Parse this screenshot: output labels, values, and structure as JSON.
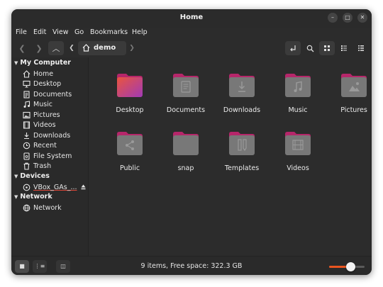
{
  "window": {
    "title": "Home",
    "controls": [
      "minimize-icon",
      "maximize-icon",
      "close-icon"
    ]
  },
  "menubar": [
    "File",
    "Edit",
    "View",
    "Go",
    "Bookmarks",
    "Help"
  ],
  "toolbar": {
    "path": "demo",
    "buttons": [
      "back-icon",
      "forward-icon",
      "parent-folder-icon",
      "path-left-icon",
      "home-icon",
      "path-right-icon",
      "toggle-location-icon",
      "search-icon",
      "icon-view-icon",
      "list-view-icon",
      "compact-view-icon"
    ]
  },
  "sidebar": {
    "sections": [
      {
        "title": "My Computer",
        "items": [
          {
            "label": "Home",
            "icon": "home-icon"
          },
          {
            "label": "Desktop",
            "icon": "desktop-icon"
          },
          {
            "label": "Documents",
            "icon": "documents-icon"
          },
          {
            "label": "Music",
            "icon": "music-icon"
          },
          {
            "label": "Pictures",
            "icon": "pictures-icon"
          },
          {
            "label": "Videos",
            "icon": "videos-icon"
          },
          {
            "label": "Downloads",
            "icon": "downloads-icon"
          },
          {
            "label": "Recent",
            "icon": "recent-icon"
          },
          {
            "label": "File System",
            "icon": "filesystem-icon"
          },
          {
            "label": "Trash",
            "icon": "trash-icon"
          }
        ]
      },
      {
        "title": "Devices",
        "items": [
          {
            "label": "VBox_GAs_...",
            "icon": "disc-icon",
            "extra": "eject-icon"
          }
        ]
      },
      {
        "title": "Network",
        "items": [
          {
            "label": "Network",
            "icon": "network-icon"
          }
        ]
      }
    ]
  },
  "files": [
    {
      "name": "Desktop",
      "emblem": "none",
      "colors": [
        "#e9543e",
        "#a13ab6"
      ]
    },
    {
      "name": "Documents",
      "emblem": "document",
      "colors": [
        "#7f7f7f",
        "#6a6a6a"
      ]
    },
    {
      "name": "Downloads",
      "emblem": "download",
      "colors": [
        "#7f7f7f",
        "#6a6a6a"
      ]
    },
    {
      "name": "Music",
      "emblem": "music",
      "colors": [
        "#7f7f7f",
        "#6a6a6a"
      ]
    },
    {
      "name": "Pictures",
      "emblem": "picture",
      "colors": [
        "#7f7f7f",
        "#6a6a6a"
      ]
    },
    {
      "name": "Public",
      "emblem": "share",
      "colors": [
        "#7f7f7f",
        "#6a6a6a"
      ]
    },
    {
      "name": "snap",
      "emblem": "none",
      "colors": [
        "#7f7f7f",
        "#6a6a6a"
      ]
    },
    {
      "name": "Templates",
      "emblem": "template",
      "colors": [
        "#7f7f7f",
        "#6a6a6a"
      ]
    },
    {
      "name": "Videos",
      "emblem": "video",
      "colors": [
        "#7f7f7f",
        "#6a6a6a"
      ]
    }
  ],
  "statusbar": {
    "text": "9 items, Free space: 322.3 GB",
    "zoom_level": 0.6
  },
  "colors": {
    "accent": "#e95420",
    "folder_tab": "#b6266a",
    "window_bg": "#2c2c2c"
  }
}
